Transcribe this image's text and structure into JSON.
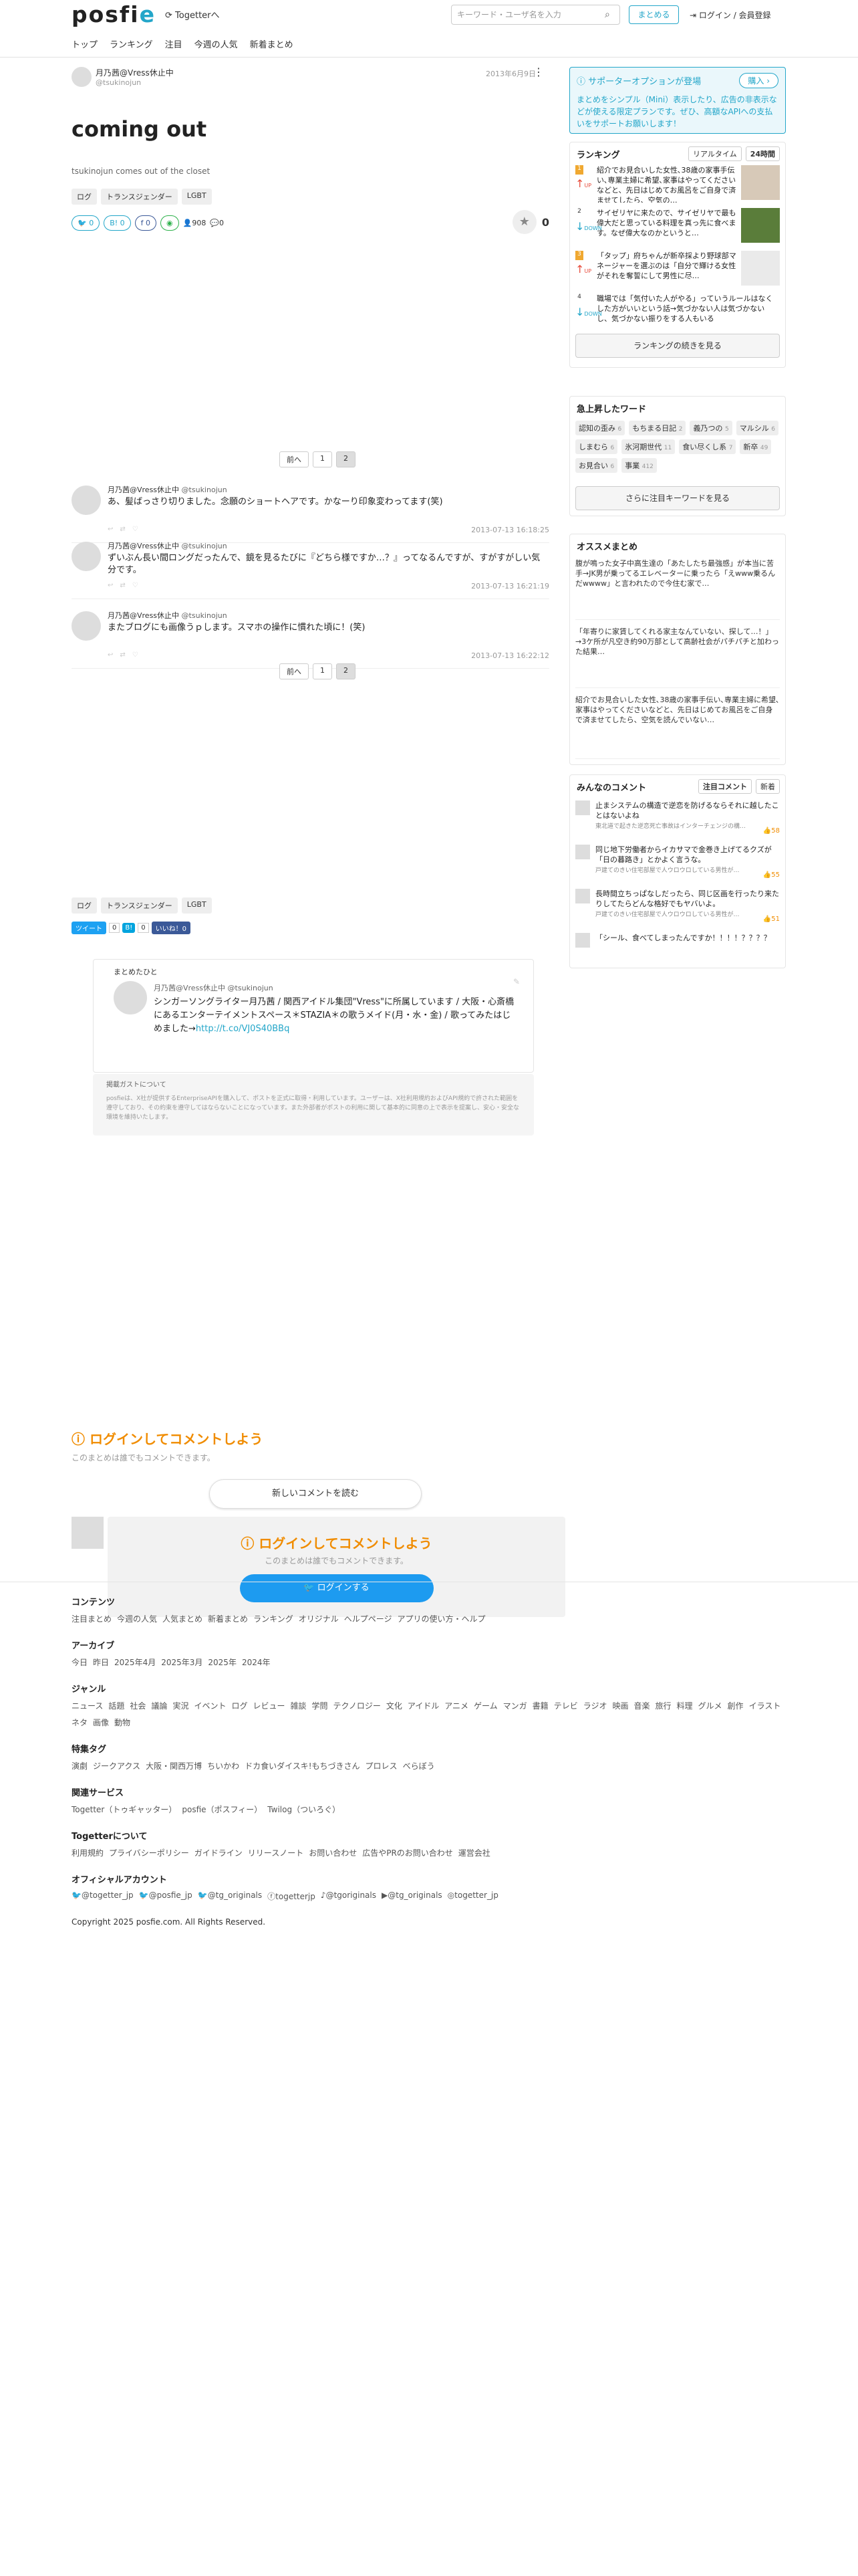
{
  "header": {
    "logo": "posfie",
    "togetter_link": "Togetterへ",
    "nav": [
      "トップ",
      "ランキング",
      "注目",
      "今週の人気",
      "新着まとめ"
    ],
    "search_placeholder": "キーワード・ユーザ名を入力",
    "matome_button": "まとめる",
    "login_link": "ログイン / 会員登録"
  },
  "article": {
    "author_name": "月乃茜@Vress休止中",
    "author_id": "@tsukinojun",
    "date": "2013年6月9日",
    "title": "coming out",
    "description": "tsukinojun comes out of the closet",
    "tags": [
      "ログ",
      "トランスジェンダー",
      "LGBT"
    ],
    "stats": {
      "tw": "0",
      "hatena": "0",
      "fb": "0",
      "views": "908",
      "comments": "0"
    },
    "favorites": "0"
  },
  "pager": {
    "prev": "前へ",
    "pages": [
      "1",
      "2"
    ],
    "current": "2"
  },
  "tweets": [
    {
      "name": "月乃茜@Vress休止中",
      "id": "@tsukinojun",
      "text": "あ、髪ばっさり切りました。念願のショートヘアです。かなーり印象変わってます(笑)",
      "time": "2013-07-13 16:18:25"
    },
    {
      "name": "月乃茜@Vress休止中",
      "id": "@tsukinojun",
      "text": "ずいぶん長い間ロングだったんで、鏡を見るたびに『どちら様ですか…？』ってなるんですが、すがすがしい気分です。",
      "time": "2013-07-13 16:21:19"
    },
    {
      "name": "月乃茜@Vress休止中",
      "id": "@tsukinojun",
      "text": "またブログにも画像うｐします。スマホの操作に慣れた頃に！(笑)",
      "time": "2013-07-13 16:22:12"
    }
  ],
  "share": {
    "tweet": "ツイート",
    "tweet_count": "0",
    "b_count": "0",
    "fb": "いいね！0"
  },
  "profile_card": {
    "label": "まとめたひと",
    "name": "月乃茜@Vress休止中",
    "id": "@tsukinojun",
    "bio": "シンガーソングライター月乃茜 / 関西アイドル集団\"Vress\"に所属しています / 大阪・心斎橋にあるエンターテイメントスペース＊STAZIA＊の歌うメイド(月・水・金) / 歌ってみたはじめました→",
    "bio_link": "http://t.co/VJ0S40BBq"
  },
  "notice": {
    "heading": "掲載ガストについて",
    "body": "posfieは、X社が提供するEnterpriseAPIを購入して、ポストを正式に取得・利用しています。ユーザーは、X社利用規約およびAPI規約で許された範囲を遵守しており、その約束を遵守してはならないことになっています。また外部者がポストの利用に関して基本的に同意の上で表示を提案し、安心・安全な環境を維持いたします。"
  },
  "login_cta": {
    "title": "ログインしてコメントしよう",
    "sub": "このまとめは誰でもコメントできます。"
  },
  "new_comments_button": "新しいコメントを読む",
  "comment_box": {
    "title": "ログインしてコメントしよう",
    "sub": "このまとめは誰でもコメントできます。",
    "button": "ログインする"
  },
  "sidebar": {
    "supporter": {
      "title": "サポーターオプションが登場",
      "button": "購入 ›",
      "desc": "まとめをシンプル（Mini）表示したり、広告の非表示などが使える限定プランです。ぜひ、高額なAPIへの支払いをサポートお願いします！"
    },
    "ranking": {
      "title": "ランキング",
      "tabs": [
        "リアルタイム",
        "24時間"
      ],
      "items": [
        {
          "rank": "1",
          "move": "UP",
          "text": "紹介でお見合いした女性､38歳の家事手伝い､専業主婦に希望､家事はやってくださいなどと、先日はじめてお風呂をご自身で済ませてしたら、空気の…"
        },
        {
          "rank": "2",
          "move": "DOWN",
          "text": "サイゼリヤに来たので、サイゼリヤで最も偉大だと思っている料理を真っ先に食べます。なぜ偉大なのかというと…"
        },
        {
          "rank": "3",
          "move": "UP",
          "text": "「タップ」府ちゃんが新卒採より野球部マネージャーを選ぶのは「自分で輝ける女性がそれを奪誓にして男性に尽…"
        },
        {
          "rank": "4",
          "move": "DOWN",
          "text": "職場では「気付いた人がやる」っていうルールはなくした方がいいという話→気づかない人は気づかないし、気づかない振りをする人もいる"
        }
      ],
      "more": "ランキングの続きを見る"
    },
    "keywords": {
      "title": "急上昇したワード",
      "items": [
        {
          "w": "認知の歪み",
          "n": "6"
        },
        {
          "w": "もちまる日記",
          "n": "2"
        },
        {
          "w": "義乃つの",
          "n": "5"
        },
        {
          "w": "マルシル",
          "n": "6"
        },
        {
          "w": "しまむら",
          "n": "6"
        },
        {
          "w": "氷河期世代",
          "n": "11"
        },
        {
          "w": "食い尽くし系",
          "n": "7"
        },
        {
          "w": "新卒",
          "n": "49"
        },
        {
          "w": "お見合い",
          "n": "6"
        },
        {
          "w": "事業",
          "n": "412"
        }
      ],
      "more": "さらに注目キーワードを見る"
    },
    "osusume": {
      "title": "オススメまとめ",
      "items": [
        {
          "text": "腹が鳴った女子中高生達の「あたしたち最強感」が本当に苦手→JK男が乗ってるエレベーターに乗ったら「えwww乗るんだwwww」と言われたので今住む家で…"
        },
        {
          "text": "「年寄りに家賃してくれる家主なんていない、探して…！」→3ケ所が凡空き約90万部として高齢社会がパチパチと加わった結果…"
        },
        {
          "text": "紹介でお見合いした女性､38歳の家事手伝い､専業主婦に希望､家事はやってくださいなどと、先日はじめてお風呂をご自身で済ませてしたら、空気を読んでいない…"
        }
      ]
    },
    "comments": {
      "title": "みんなのコメント",
      "tabs": [
        "注目コメント",
        "新着"
      ],
      "items": [
        {
          "text": "止まシステムの構造で逆恋を防げるならそれに越したことはないよね",
          "sub": "東北道で起きた逆恋死亡事故はインターチェンジの構…",
          "likes": "58"
        },
        {
          "text": "同じ地下労働者からイカサマで金巻き上げてるクズが「日の暮路き」とかよく言うな。",
          "sub": "戸建てのきい住宅部屋で人ウロウロしている男性が…",
          "likes": "55"
        },
        {
          "text": "長時間立ちっぱなしだったら、同じ区画を行ったり来たりしてたらどんな格好でもヤバいよ。",
          "sub": "戸建てのきい住宅部屋で人ウロウロしている男性が…",
          "likes": "51"
        },
        {
          "text": "「シール、食べてしまったんですか！！！！？？？？",
          "sub": "",
          "likes": ""
        }
      ]
    }
  },
  "footer": {
    "sections": [
      {
        "h": "コンテンツ",
        "links": [
          "注目まとめ",
          "今週の人気",
          "人気まとめ",
          "新着まとめ",
          "ランキング",
          "オリジナル",
          "ヘルプページ",
          "アプリの使い方・ヘルプ"
        ]
      },
      {
        "h": "アーカイブ",
        "links": [
          "今日",
          "昨日",
          "2025年4月",
          "2025年3月",
          "2025年",
          "2024年"
        ]
      },
      {
        "h": "ジャンル",
        "links": [
          "ニュース",
          "話題",
          "社会",
          "議論",
          "実況",
          "イベント",
          "ログ",
          "レビュー",
          "雑談",
          "学問",
          "テクノロジー",
          "文化",
          "アイドル",
          "アニメ",
          "ゲーム",
          "マンガ",
          "書籍",
          "テレビ",
          "ラジオ",
          "映画",
          "音楽",
          "旅行",
          "料理",
          "グルメ",
          "創作",
          "イラスト",
          "ネタ",
          "画像",
          "動物"
        ]
      },
      {
        "h": "特集タグ",
        "links": [
          "演劇",
          "ジークアクス",
          "大阪・関西万博",
          "ちいかわ",
          "ドカ食いダイスキ!もちづきさん",
          "プロレス",
          "べらぼう"
        ]
      },
      {
        "h": "関連サービス",
        "links": [
          "Togetter（トゥギャッター）",
          "posfie（ポスフィー）",
          "Twilog（ついろぐ）"
        ]
      },
      {
        "h": "Togetterについて",
        "links": [
          "利用規約",
          "プライバシーポリシー",
          "ガイドライン",
          "リリースノート",
          "お問い合わせ",
          "広告やPRのお問い合わせ",
          "運営会社"
        ]
      },
      {
        "h": "オフィシャルアカウント",
        "links": [
          "@togetter_jp",
          "@posfie_jp",
          "@tg_originals",
          "togetterjp",
          "@tgoriginals",
          "@tg_originals",
          "togetter_jp"
        ]
      }
    ],
    "copyright": "Copyright 2025 posfie.com. All Rights Reserved."
  }
}
